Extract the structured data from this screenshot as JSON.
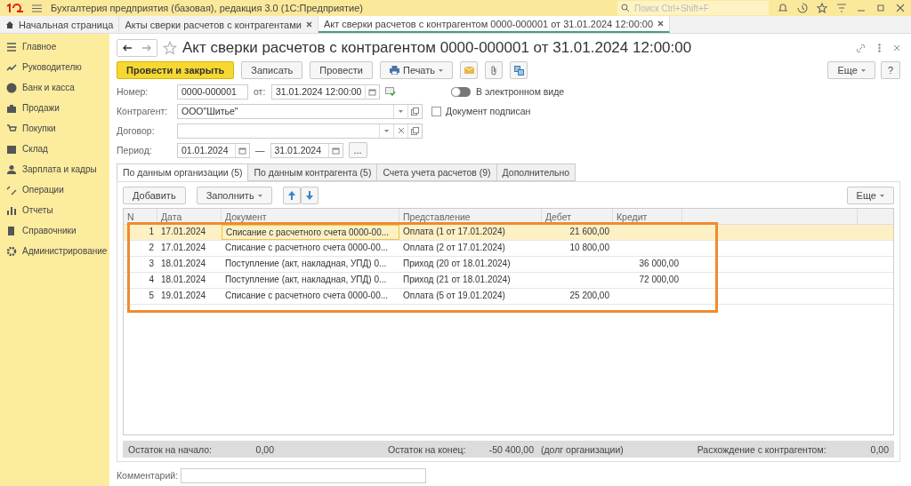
{
  "app": {
    "title": "Бухгалтерия предприятия (базовая), редакция 3.0  (1С:Предприятие)",
    "search_placeholder": "Поиск Ctrl+Shift+F"
  },
  "tabs": [
    {
      "label": "Начальная страница",
      "selected": false,
      "closable": false
    },
    {
      "label": "Акты сверки расчетов с контрагентами",
      "selected": false,
      "closable": true
    },
    {
      "label": "Акт сверки расчетов с контрагентом 0000-000001 от 31.01.2024 12:00:00",
      "selected": true,
      "closable": true
    }
  ],
  "sidebar": {
    "items": [
      {
        "label": "Главное"
      },
      {
        "label": "Руководителю"
      },
      {
        "label": "Банк и касса"
      },
      {
        "label": "Продажи"
      },
      {
        "label": "Покупки"
      },
      {
        "label": "Склад"
      },
      {
        "label": "Зарплата и кадры"
      },
      {
        "label": "Операции"
      },
      {
        "label": "Отчеты"
      },
      {
        "label": "Справочники"
      },
      {
        "label": "Администрирование"
      }
    ]
  },
  "document": {
    "title": "Акт сверки расчетов с контрагентом 0000-000001 от 31.01.2024 12:00:00",
    "toolbar": {
      "primary": "Провести и закрыть",
      "write": "Записать",
      "post": "Провести",
      "print": "Печать",
      "more": "Еще",
      "help": "?"
    },
    "number": {
      "label": "Номер:",
      "value": "0000-000001",
      "date_label": "от:",
      "date": "31.01.2024 12:00:00"
    },
    "electronic": {
      "label": "В электронном виде",
      "on": false
    },
    "counterparty": {
      "label": "Контрагент:",
      "value": "ООО\"Шитье\""
    },
    "signed": {
      "label": "Документ подписан",
      "checked": false
    },
    "contract": {
      "label": "Договор:"
    },
    "period": {
      "label": "Период:",
      "from": "01.01.2024",
      "to": "31.01.2024",
      "dash": "—",
      "more": "..."
    },
    "subtabs": [
      {
        "label": "По данным организации (5)",
        "selected": true
      },
      {
        "label": "По данным контрагента (5)",
        "selected": false
      },
      {
        "label": "Счета учета расчетов (9)",
        "selected": false
      },
      {
        "label": "Дополнительно",
        "selected": false
      }
    ],
    "table_toolbar": {
      "add": "Добавить",
      "fill": "Заполнить",
      "more": "Еще"
    },
    "table": {
      "columns": [
        "N",
        "Дата",
        "Документ",
        "Представление",
        "Дебет",
        "Кредит"
      ],
      "rows": [
        {
          "n": "1",
          "date": "17.01.2024",
          "document": "Списание с расчетного счета 0000-00...",
          "presentation": "Оплата (1 от 17.01.2024)",
          "debit": "21 600,00",
          "credit": "",
          "selected": true
        },
        {
          "n": "2",
          "date": "17.01.2024",
          "document": "Списание с расчетного счета 0000-00...",
          "presentation": "Оплата (2 от 17.01.2024)",
          "debit": "10 800,00",
          "credit": "",
          "selected": false
        },
        {
          "n": "3",
          "date": "18.01.2024",
          "document": "Поступление (акт, накладная, УПД) 0...",
          "presentation": "Приход (20 от 18.01.2024)",
          "debit": "",
          "credit": "36 000,00",
          "selected": false
        },
        {
          "n": "4",
          "date": "18.01.2024",
          "document": "Поступление (акт, накладная, УПД) 0...",
          "presentation": "Приход (21 от 18.01.2024)",
          "debit": "",
          "credit": "72 000,00",
          "selected": false
        },
        {
          "n": "5",
          "date": "19.01.2024",
          "document": "Списание с расчетного счета 0000-00...",
          "presentation": "Оплата (5 от 19.01.2024)",
          "debit": "25 200,00",
          "credit": "",
          "selected": false
        }
      ]
    },
    "summary": {
      "start_label": "Остаток на начало:",
      "start": "0,00",
      "end_label": "Остаток на конец:",
      "end": "-50 400,00",
      "end_note": "(долг организации)",
      "diff_label": "Расхождение с контрагентом:",
      "diff": "0,00"
    },
    "comment": {
      "label": "Комментарий:"
    }
  }
}
